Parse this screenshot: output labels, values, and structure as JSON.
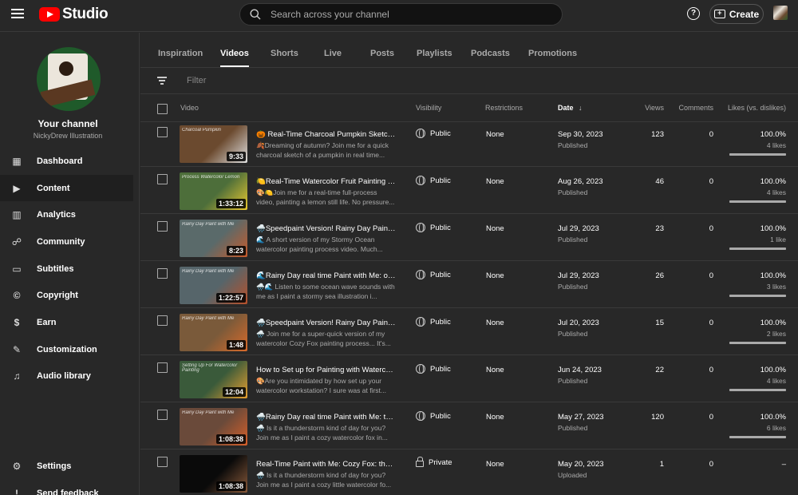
{
  "app": {
    "logo_text": "Studio"
  },
  "search": {
    "placeholder": "Search across your channel"
  },
  "header": {
    "help_glyph": "?",
    "create_label": "Create"
  },
  "sidebar": {
    "your_channel": "Your channel",
    "channel_name": "NickyDrew Illustration",
    "items": [
      {
        "label": "Dashboard",
        "icon": "dashboard-icon",
        "glyph": "▦",
        "active": false
      },
      {
        "label": "Content",
        "icon": "content-icon",
        "glyph": "▶",
        "active": true
      },
      {
        "label": "Analytics",
        "icon": "analytics-icon",
        "glyph": "▥",
        "active": false
      },
      {
        "label": "Community",
        "icon": "community-icon",
        "glyph": "☍",
        "active": false
      },
      {
        "label": "Subtitles",
        "icon": "subtitles-icon",
        "glyph": "▭",
        "active": false
      },
      {
        "label": "Copyright",
        "icon": "copyright-icon",
        "glyph": "©",
        "active": false
      },
      {
        "label": "Earn",
        "icon": "earn-icon",
        "glyph": "$",
        "active": false
      },
      {
        "label": "Customization",
        "icon": "customization-icon",
        "glyph": "✎",
        "active": false
      },
      {
        "label": "Audio library",
        "icon": "audio-library-icon",
        "glyph": "♫",
        "active": false
      },
      {
        "label": "Settings",
        "icon": "settings-icon",
        "glyph": "⚙",
        "active": false
      },
      {
        "label": "Send feedback",
        "icon": "feedback-icon",
        "glyph": "!",
        "active": false
      }
    ]
  },
  "tabs": [
    {
      "label": "Inspiration",
      "active": false
    },
    {
      "label": "Videos",
      "active": true
    },
    {
      "label": "Shorts",
      "active": false
    },
    {
      "label": "Live",
      "active": false
    },
    {
      "label": "Posts",
      "active": false
    },
    {
      "label": "Playlists",
      "active": false
    },
    {
      "label": "Podcasts",
      "active": false
    },
    {
      "label": "Promotions",
      "active": false
    }
  ],
  "filter": {
    "placeholder": "Filter"
  },
  "table": {
    "headers": {
      "video": "Video",
      "visibility": "Visibility",
      "restrictions": "Restrictions",
      "date": "Date",
      "sort_arrow": "↓",
      "views": "Views",
      "comments": "Comments",
      "likes": "Likes (vs. dislikes)"
    },
    "rows": [
      {
        "title": "🎃 Real-Time Charcoal Pumpkin Sketch: Autumn Art",
        "description": "🍂Dreaming of autumn? Join me for a quick charcoal sketch of a pumpkin in real time...",
        "duration": "9:33",
        "thumb_color": "#6b4a2f",
        "thumb_accent": "#e0e0e0",
        "thumb_text": "Charcoal Pumpkin",
        "visibility": "Public",
        "vis_icon": "globe-icon",
        "restrictions": "None",
        "date": "Sep 30, 2023",
        "status": "Published",
        "views": "123",
        "comments": "0",
        "likes_pct": "100.0%",
        "likes_count": "4 likes",
        "likes_fraction": 1.0
      },
      {
        "title": "🍋Real-Time Watercolor Fruit Painting With Me",
        "description": "🎨🍋Join me for a real-time full-process video, painting a lemon still life. No pressure...",
        "duration": "1:33:12",
        "thumb_color": "#4d6e3a",
        "thumb_accent": "#e8c830",
        "thumb_text": "Process Watercolor Lemon",
        "visibility": "Public",
        "vis_icon": "globe-icon",
        "restrictions": "None",
        "date": "Aug 26, 2023",
        "status": "Published",
        "views": "46",
        "comments": "0",
        "likes_pct": "100.0%",
        "likes_count": "4 likes",
        "likes_fraction": 1.0
      },
      {
        "title": "🌧️Speedpaint Version! Rainy Day Paint with Me",
        "description": "🌊 A short version of my Stormy Ocean watercolor painting process video. Much...",
        "duration": "8:23",
        "thumb_color": "#5a6a6a",
        "thumb_accent": "#c85a2a",
        "thumb_text": "Rainy Day Paint with Me",
        "visibility": "Public",
        "vis_icon": "globe-icon",
        "restrictions": "None",
        "date": "Jul 29, 2023",
        "status": "Published",
        "views": "23",
        "comments": "0",
        "likes_pct": "100.0%",
        "likes_count": "1 like",
        "likes_fraction": 1.0
      },
      {
        "title": "🌊Rainy Day real time Paint with Me: ocean",
        "description": "🌧️🌊 Listen to some ocean wave sounds with me as I paint a stormy sea illustration i...",
        "duration": "1:22:57",
        "thumb_color": "#56656a",
        "thumb_accent": "#b8502a",
        "thumb_text": "Rainy Day Paint with Me",
        "visibility": "Public",
        "vis_icon": "globe-icon",
        "restrictions": "None",
        "date": "Jul 29, 2023",
        "status": "Published",
        "views": "26",
        "comments": "0",
        "likes_pct": "100.0%",
        "likes_count": "3 likes",
        "likes_fraction": 1.0
      },
      {
        "title": "🌧️Speedpaint Version! Rainy Day Paint with Me",
        "description": "🌧️ Join me for a super-quick version of my watercolor Cozy Fox painting process... It's...",
        "duration": "1:48",
        "thumb_color": "#7a5a3a",
        "thumb_accent": "#d86a2a",
        "thumb_text": "Rainy Day Paint with Me",
        "visibility": "Public",
        "vis_icon": "globe-icon",
        "restrictions": "None",
        "date": "Jul 20, 2023",
        "status": "Published",
        "views": "15",
        "comments": "0",
        "likes_pct": "100.0%",
        "likes_count": "2 likes",
        "likes_fraction": 1.0
      },
      {
        "title": "How to Set up for Painting with Watercolor",
        "description": "🎨Are you intimidated by how set up your watercolor workstation? I sure was at first...",
        "duration": "12:04",
        "thumb_color": "#3a5a3a",
        "thumb_accent": "#e8a030",
        "thumb_text": "Setting Up For Watercolor Painting",
        "visibility": "Public",
        "vis_icon": "globe-icon",
        "restrictions": "None",
        "date": "Jun 24, 2023",
        "status": "Published",
        "views": "22",
        "comments": "0",
        "likes_pct": "100.0%",
        "likes_count": "4 likes",
        "likes_fraction": 1.0
      },
      {
        "title": "🌧️Rainy Day real time Paint with Me: thunder",
        "description": "🌧️ Is it a thunderstorm kind of day for you? Join me as I paint a cozy watercolor fox in...",
        "duration": "1:08:38",
        "thumb_color": "#6a4a3a",
        "thumb_accent": "#d8602a",
        "thumb_text": "Rainy Day Paint with Me",
        "visibility": "Public",
        "vis_icon": "globe-icon",
        "restrictions": "None",
        "date": "May 27, 2023",
        "status": "Published",
        "views": "120",
        "comments": "0",
        "likes_pct": "100.0%",
        "likes_count": "6 likes",
        "likes_fraction": 1.0
      },
      {
        "title": "Real-Time Paint with Me: Cozy Fox: thunder",
        "description": "🌧️ Is it a thunderstorm kind of day for you? Join me as I paint a cozy little watercolor fo...",
        "duration": "1:08:38",
        "thumb_color": "#0a0a0a",
        "thumb_accent": "#8a5a3a",
        "thumb_text": "",
        "visibility": "Private",
        "vis_icon": "lock-icon",
        "restrictions": "None",
        "date": "May 20, 2023",
        "status": "Uploaded",
        "views": "1",
        "comments": "0",
        "likes_pct": "–",
        "likes_count": "",
        "likes_fraction": null
      }
    ]
  }
}
